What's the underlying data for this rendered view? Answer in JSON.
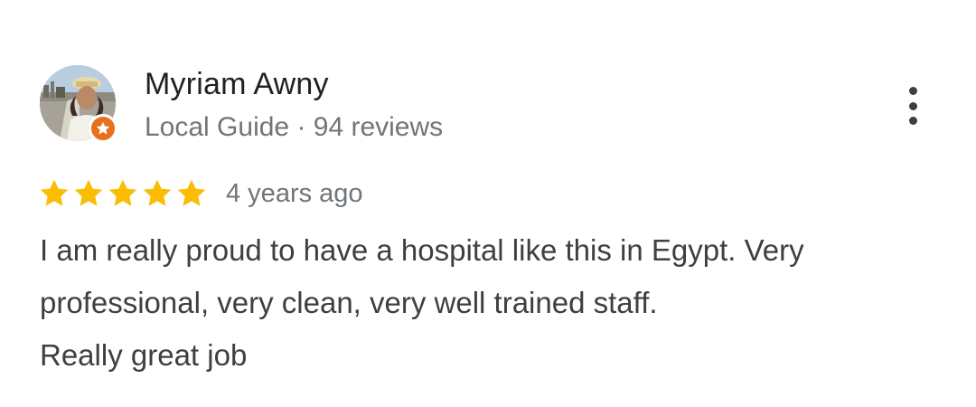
{
  "reviewer": {
    "name": "Myriam Awny",
    "meta": "Local Guide · 94 reviews",
    "avatar_icon": "profile-photo",
    "badge_icon": "local-guide-star-icon",
    "badge_color": "#e8711c"
  },
  "rating": {
    "stars": 5,
    "max_stars": 5,
    "star_color": "#fbbc04",
    "date": "4 years ago"
  },
  "review": {
    "line1": "I am really proud to have a hospital like this in Egypt. Very",
    "line2": "professional, very clean, very well trained staff.",
    "line3": "Really great job"
  },
  "menu": {
    "icon": "more-vert-icon"
  }
}
